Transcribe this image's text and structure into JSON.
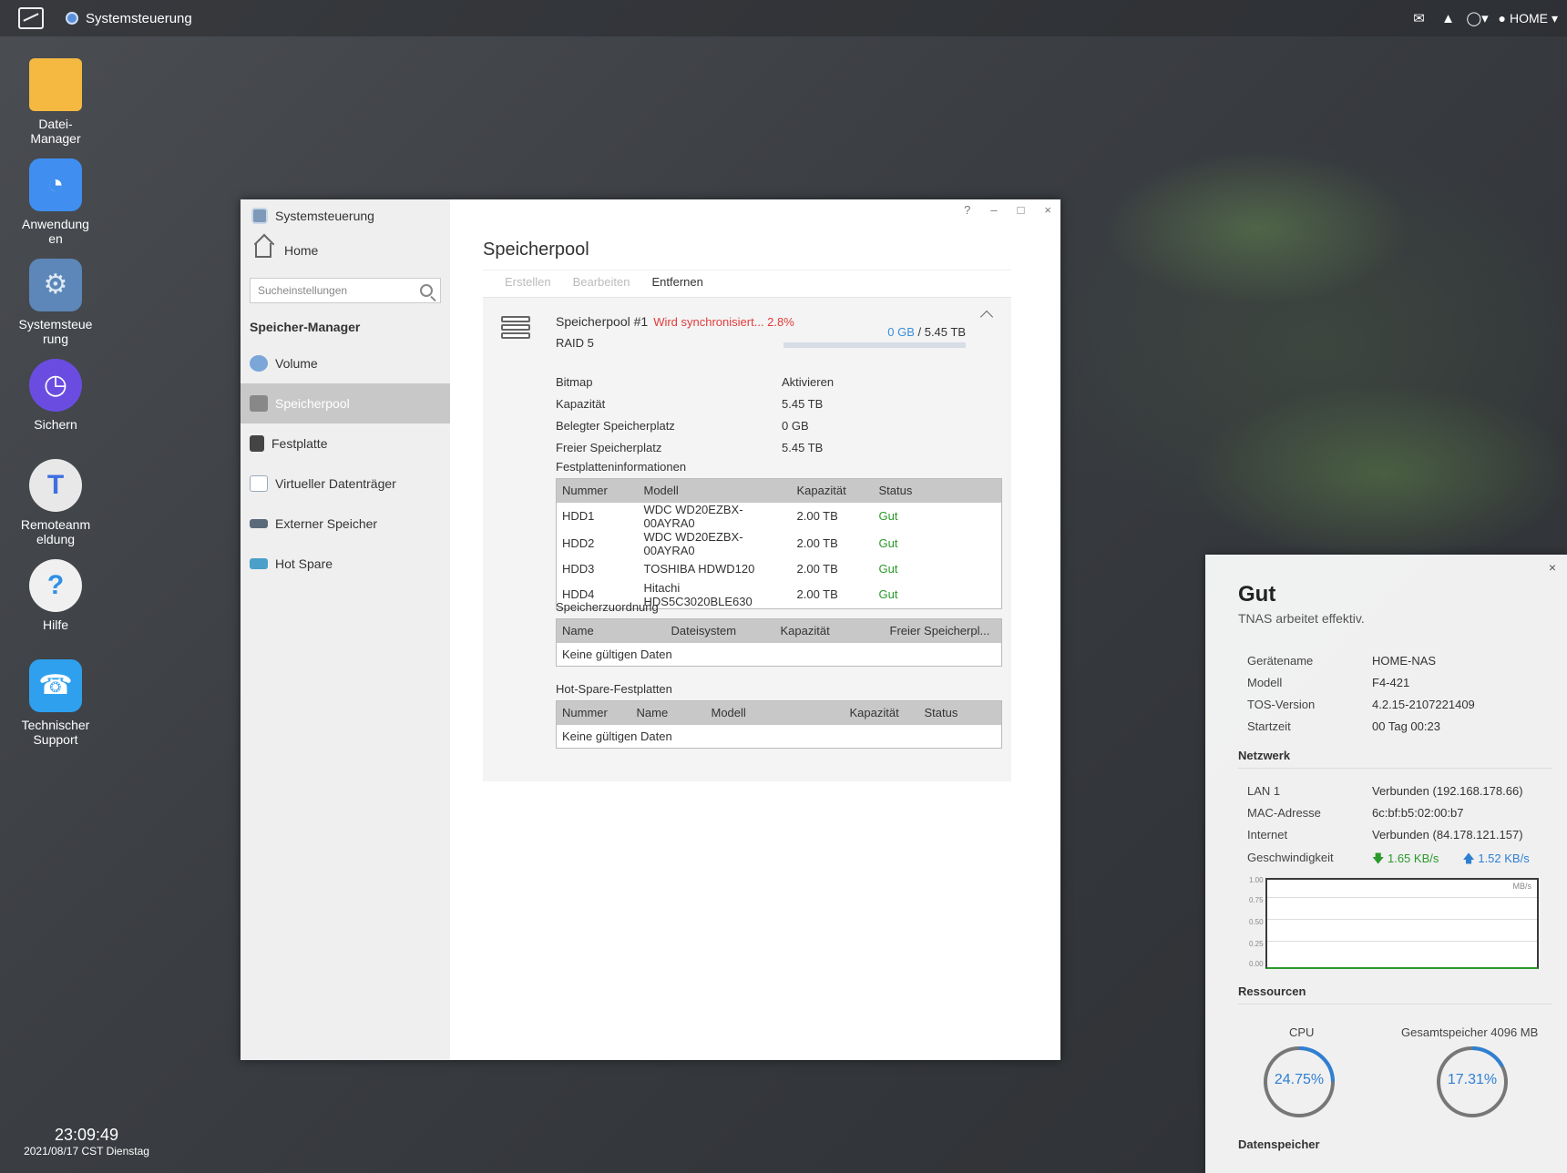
{
  "topbar": {
    "app_title": "Systemsteuerung",
    "user": "HOME",
    "icons": [
      "chat-icon",
      "bell-icon",
      "globe-icon",
      "user-icon"
    ]
  },
  "desktop": [
    {
      "label": "Datei-\nManager",
      "icon": "folder-icon",
      "color": "#f5b942"
    },
    {
      "label": "Anwendung\nen",
      "icon": "bag-icon",
      "color": "#3f8ef0"
    },
    {
      "label": "Systemsteue\nrung",
      "icon": "gear-icon",
      "color": "#5c87b8"
    },
    {
      "label": "Sichern",
      "icon": "clock-icon",
      "color": "#6a4de0"
    },
    {
      "label": "Remoteanm\neldung",
      "icon": "cloud-icon",
      "color": "#e8e8e8"
    },
    {
      "label": "Hilfe",
      "icon": "help-icon",
      "color": "#f0f0f0"
    },
    {
      "label": "Technischer\nSupport",
      "icon": "headset-icon",
      "color": "#2fa0ee"
    }
  ],
  "window": {
    "title": "Systemsteuerung",
    "home": "Home",
    "search_placeholder": "Sucheinstellungen",
    "section": "Speicher-Manager",
    "nav": [
      "Volume",
      "Speicherpool",
      "Festplatte",
      "Virtueller Datenträger",
      "Externer Speicher",
      "Hot Spare"
    ],
    "controls": [
      "?",
      "–",
      "□",
      "×"
    ],
    "page_title": "Speicherpool",
    "tabs": [
      "Erstellen",
      "Bearbeiten",
      "Entfernen"
    ],
    "pool": {
      "name": "Speicherpool #1",
      "sync": "Wird synchronisiert... 2.8%",
      "raid": "RAID 5",
      "used": "0 GB",
      "total": "/ 5.45 TB",
      "usage_fraction": 0.0,
      "props": [
        {
          "k": "Bitmap",
          "v": "Aktivieren"
        },
        {
          "k": "Kapazität",
          "v": "5.45 TB"
        },
        {
          "k": "Belegter Speicherplatz",
          "v": "0 GB"
        },
        {
          "k": "Freier Speicherplatz",
          "v": "5.45 TB"
        }
      ]
    },
    "disks_title": "Festplatteninformationen",
    "disks_headers": [
      "Nummer",
      "Modell",
      "Kapazität",
      "Status"
    ],
    "disks": [
      [
        "HDD1",
        "WDC WD20EZBX-00AYRA0",
        "2.00 TB",
        "Gut"
      ],
      [
        "HDD2",
        "WDC WD20EZBX-00AYRA0",
        "2.00 TB",
        "Gut"
      ],
      [
        "HDD3",
        "TOSHIBA HDWD120",
        "2.00 TB",
        "Gut"
      ],
      [
        "HDD4",
        "Hitachi HDS5C3020BLE630",
        "2.00 TB",
        "Gut"
      ]
    ],
    "alloc_title": "Speicherzuordnung",
    "alloc_headers": [
      "Name",
      "Dateisystem",
      "Kapazität",
      "Freier Speicherpl..."
    ],
    "no_data": "Keine gültigen Daten",
    "hotspare_title": "Hot-Spare-Festplatten",
    "hotspare_headers": [
      "Nummer",
      "Name",
      "Modell",
      "Kapazität",
      "Status"
    ]
  },
  "panel": {
    "status": "Gut",
    "subtitle": "TNAS arbeitet effektiv.",
    "info": [
      {
        "k": "Gerätename",
        "v": "HOME-NAS"
      },
      {
        "k": "Modell",
        "v": "F4-421"
      },
      {
        "k": "TOS-Version",
        "v": "4.2.15-2107221409"
      },
      {
        "k": "Startzeit",
        "v": "00 Tag 00:23"
      }
    ],
    "network_title": "Netzwerk",
    "network": [
      {
        "k": "LAN 1",
        "v": "Verbunden (192.168.178.66)"
      },
      {
        "k": "MAC-Adresse",
        "v": "6c:bf:b5:02:00:b7"
      },
      {
        "k": "Internet",
        "v": "Verbunden (84.178.121.157)"
      }
    ],
    "speed_label": "Geschwindigkeit",
    "down_speed": "1.65 KB/s",
    "up_speed": "1.52 KB/s",
    "graph_unit": "MB/s",
    "graph_ticks": [
      "1.00",
      "0.75",
      "0.50",
      "0.25",
      "0.00"
    ],
    "resources_title": "Ressourcen",
    "cpu_label": "CPU",
    "cpu_value": "24.75%",
    "cpu_fraction": 0.2475,
    "mem_label": "Gesamtspeicher 4096 MB",
    "mem_value": "17.31%",
    "mem_fraction": 0.1731,
    "storage_title": "Datenspeicher"
  },
  "clock": {
    "time": "23:09:49",
    "date": "2021/08/17 CST Dienstag"
  }
}
